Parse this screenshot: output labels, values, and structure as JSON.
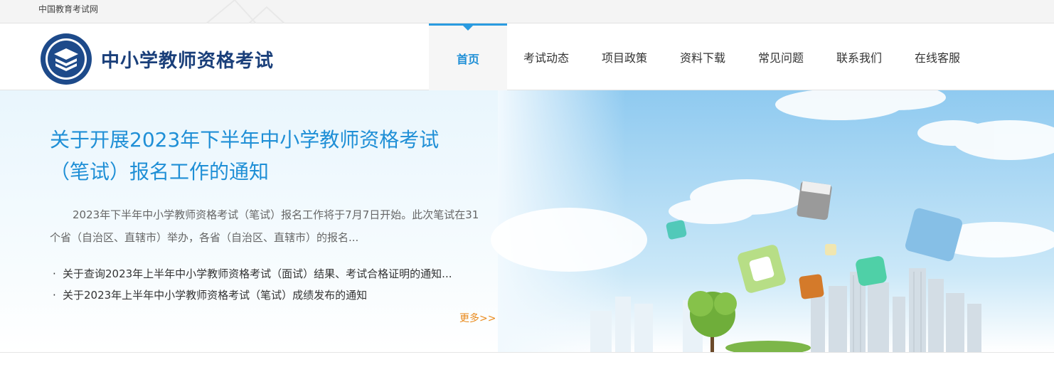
{
  "topbar": {
    "site_name": "中国教育考试网"
  },
  "header": {
    "logo_text": "中小学教师资格考试"
  },
  "nav": {
    "items": [
      {
        "label": "首页",
        "active": true
      },
      {
        "label": "考试动态"
      },
      {
        "label": "项目政策"
      },
      {
        "label": "资料下载"
      },
      {
        "label": "常见问题"
      },
      {
        "label": "联系我们"
      },
      {
        "label": "在线客服"
      }
    ]
  },
  "banner": {
    "headline": "关于开展2023年下半年中小学教师资格考试（笔试）报名工作的通知",
    "summary": "2023年下半年中小学教师资格考试（笔试）报名工作将于7月7日开始。此次笔试在31个省（自治区、直辖市）举办，各省（自治区、直辖市）的报名...",
    "news": [
      {
        "bullet": "·",
        "title": "关于查询2023年上半年中小学教师资格考试（面试）结果、考试合格证明的通知..."
      },
      {
        "bullet": "·",
        "title": "关于2023年上半年中小学教师资格考试（笔试）成绩发布的通知"
      }
    ],
    "more_label": "更多>>"
  },
  "colors": {
    "accent": "#1f8fd6",
    "logo_blue": "#1a3f7a",
    "more_orange": "#e98a1c"
  }
}
